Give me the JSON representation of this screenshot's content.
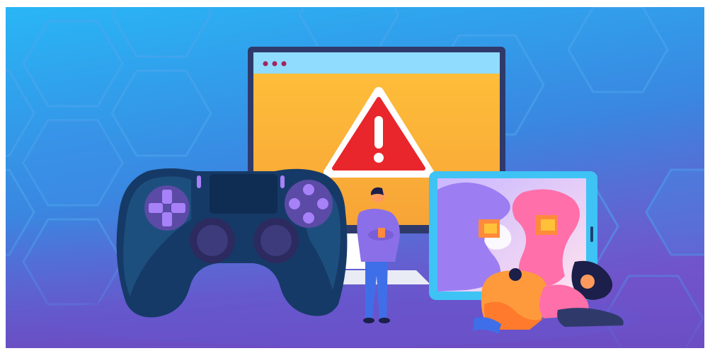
{
  "scene": {
    "subject": "illustration",
    "elements": [
      "monitor-with-warning",
      "game-controller",
      "tablet",
      "standing-person",
      "sitting-person",
      "lying-person"
    ],
    "colors": {
      "bg_top": "#29b6f6",
      "bg_bottom": "#7a4fc8",
      "hex": "#3f8fe8",
      "monitor_frame": "#2f3a6b",
      "screen_bar": "#8fdcff",
      "screen_top": "#ffc13a",
      "screen_bottom": "#f7a437",
      "warning_red": "#e8262b",
      "controller_dark": "#163a67",
      "controller_mid": "#1d4f7e",
      "button_purple": "#a781f7",
      "tablet_frame": "#3ec3f4",
      "person_purple": "#8b6fe8",
      "jeans_blue": "#3f6fe8",
      "orange": "#ff9a3c",
      "pink": "#ff6fa9"
    }
  }
}
